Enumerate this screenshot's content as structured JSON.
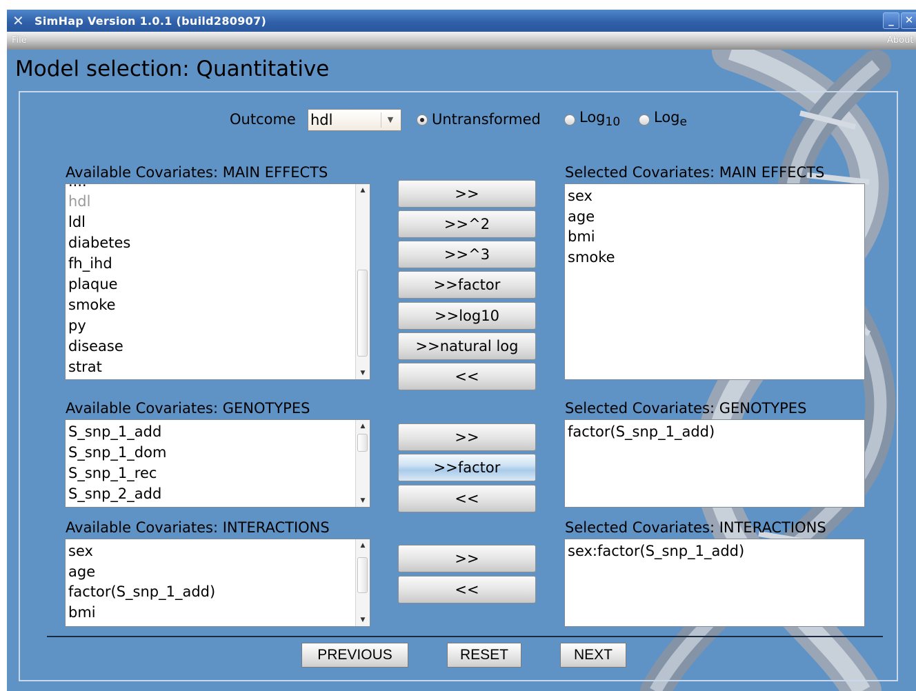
{
  "window": {
    "title": "SimHap Version 1.0.1 (build280907)",
    "minimize_glyph": "_",
    "close_glyph": "✕"
  },
  "menu": {
    "file": "File",
    "about": "About"
  },
  "page_title": "Model selection: Quantitative",
  "outcome": {
    "label": "Outcome",
    "selected": "hdl",
    "transform_options": [
      {
        "label": "Untransformed",
        "selected": true
      },
      {
        "label": "Log",
        "sub": "10",
        "selected": false
      },
      {
        "label": "Log",
        "sub": "e",
        "selected": false
      }
    ]
  },
  "main_effects": {
    "available_label": "Available Covariates: MAIN EFFECTS",
    "available_items": [
      "hdl",
      "ldl",
      "diabetes",
      "fh_ihd",
      "plaque",
      "smoke",
      "py",
      "disease",
      "strat"
    ],
    "partial_top_item": "....",
    "selected_label": "Selected Covariates: MAIN EFFECTS",
    "selected_items": [
      "sex",
      "age",
      "bmi",
      "smoke"
    ],
    "buttons": [
      ">>",
      ">>^2",
      ">>^3",
      ">>factor",
      ">>log10",
      ">>natural log",
      "<<"
    ]
  },
  "genotypes": {
    "available_label": "Available Covariates: GENOTYPES",
    "available_items": [
      "S_snp_1_add",
      "S_snp_1_dom",
      "S_snp_1_rec",
      "S_snp_2_add"
    ],
    "selected_label": "Selected Covariates: GENOTYPES",
    "selected_items": [
      "factor(S_snp_1_add)"
    ],
    "buttons": [
      ">>",
      ">>factor",
      "<<"
    ]
  },
  "interactions": {
    "available_label": "Available Covariates: INTERACTIONS",
    "available_items": [
      "sex",
      "age",
      "factor(S_snp_1_add)",
      "bmi"
    ],
    "selected_label": "Selected Covariates: INTERACTIONS",
    "selected_items": [
      "sex:factor(S_snp_1_add)"
    ],
    "buttons": [
      ">>",
      "<<"
    ]
  },
  "nav": {
    "previous": "PREVIOUS",
    "reset": "RESET",
    "next": "NEXT"
  },
  "icons": {
    "app": "x-window-icon",
    "dropdown": "chevron-down-icon",
    "scroll_up": "arrow-up-icon",
    "scroll_down": "arrow-down-icon"
  },
  "colors": {
    "background": "#5f93c6",
    "titlebar": "#2e5fa8",
    "highlight_button": "#a9cbea"
  }
}
